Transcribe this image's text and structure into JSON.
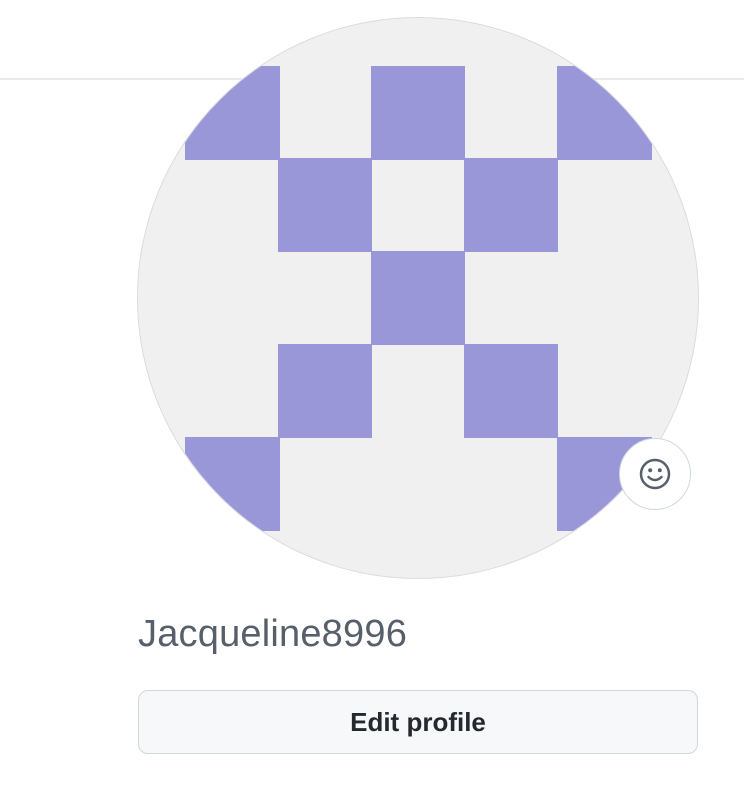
{
  "profile": {
    "username": "Jacqueline8996",
    "edit_profile_label": "Edit profile",
    "avatar_icon": "identicon",
    "status_icon": "smiley-icon"
  },
  "colors": {
    "identicon_fill": "#9a97d8",
    "avatar_background": "#f0f0f0",
    "divider": "#e8eaed",
    "username_text": "#57606a",
    "button_background": "#f6f8fa",
    "button_border": "#d0d7de"
  }
}
